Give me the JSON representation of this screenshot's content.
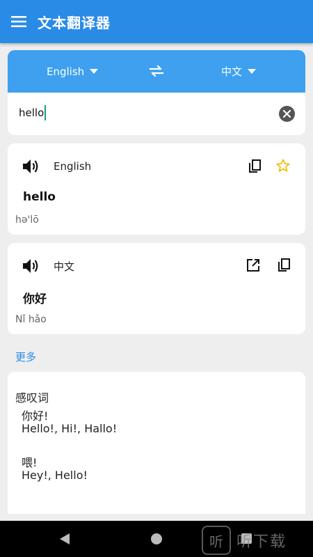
{
  "app": {
    "title": "文本翻译器"
  },
  "language_bar": {
    "source": "English",
    "target": "中文"
  },
  "input": {
    "value": "hello"
  },
  "source_card": {
    "language": "English",
    "text": "hello",
    "phonetic": "hə'lō"
  },
  "target_card": {
    "language": "中文",
    "text": "你好",
    "phonetic": "Nǐ hǎo"
  },
  "more_label": "更多",
  "dictionary": {
    "part_of_speech": "感叹词",
    "entries": [
      {
        "word": "你好!",
        "translations": "Hello!,  Hi!,  Hallo!"
      },
      {
        "word": "喂!",
        "translations": "Hey!,  Hello!"
      }
    ]
  },
  "watermark": {
    "glyph": "听",
    "text": "听下载"
  },
  "colors": {
    "app_bar": "#2a8be6",
    "language_bar": "#3ea0ef",
    "link": "#2a8be6",
    "star": "#f2c012"
  }
}
